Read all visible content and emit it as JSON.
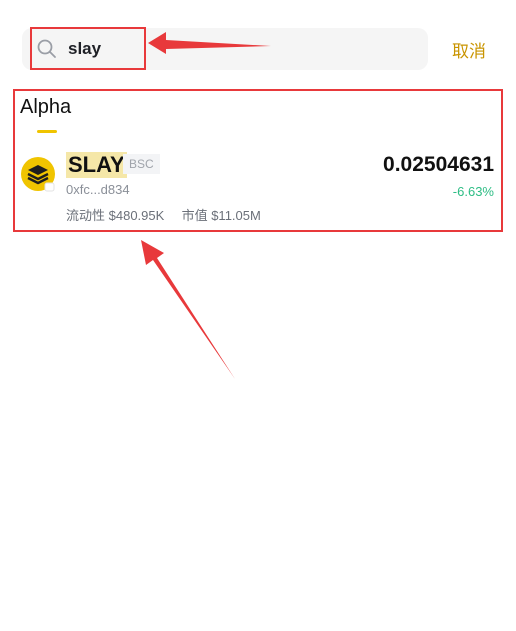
{
  "search": {
    "value": "slay"
  },
  "cancel_label": "取消",
  "section": {
    "title": "Alpha"
  },
  "token": {
    "symbol": "SLAY",
    "chain": "BSC",
    "contract": "0xfc...d834",
    "liquidity_label": "流动性",
    "liquidity_value": "$480.95K",
    "mcap_label": "市值",
    "mcap_value": "$11.05M",
    "price": "0.02504631",
    "change": "-6.63%"
  },
  "colors": {
    "accent": "#c99400",
    "highlight": "#e8393b",
    "positive_negative": "#2ebd85",
    "logo": "#f0c400"
  }
}
